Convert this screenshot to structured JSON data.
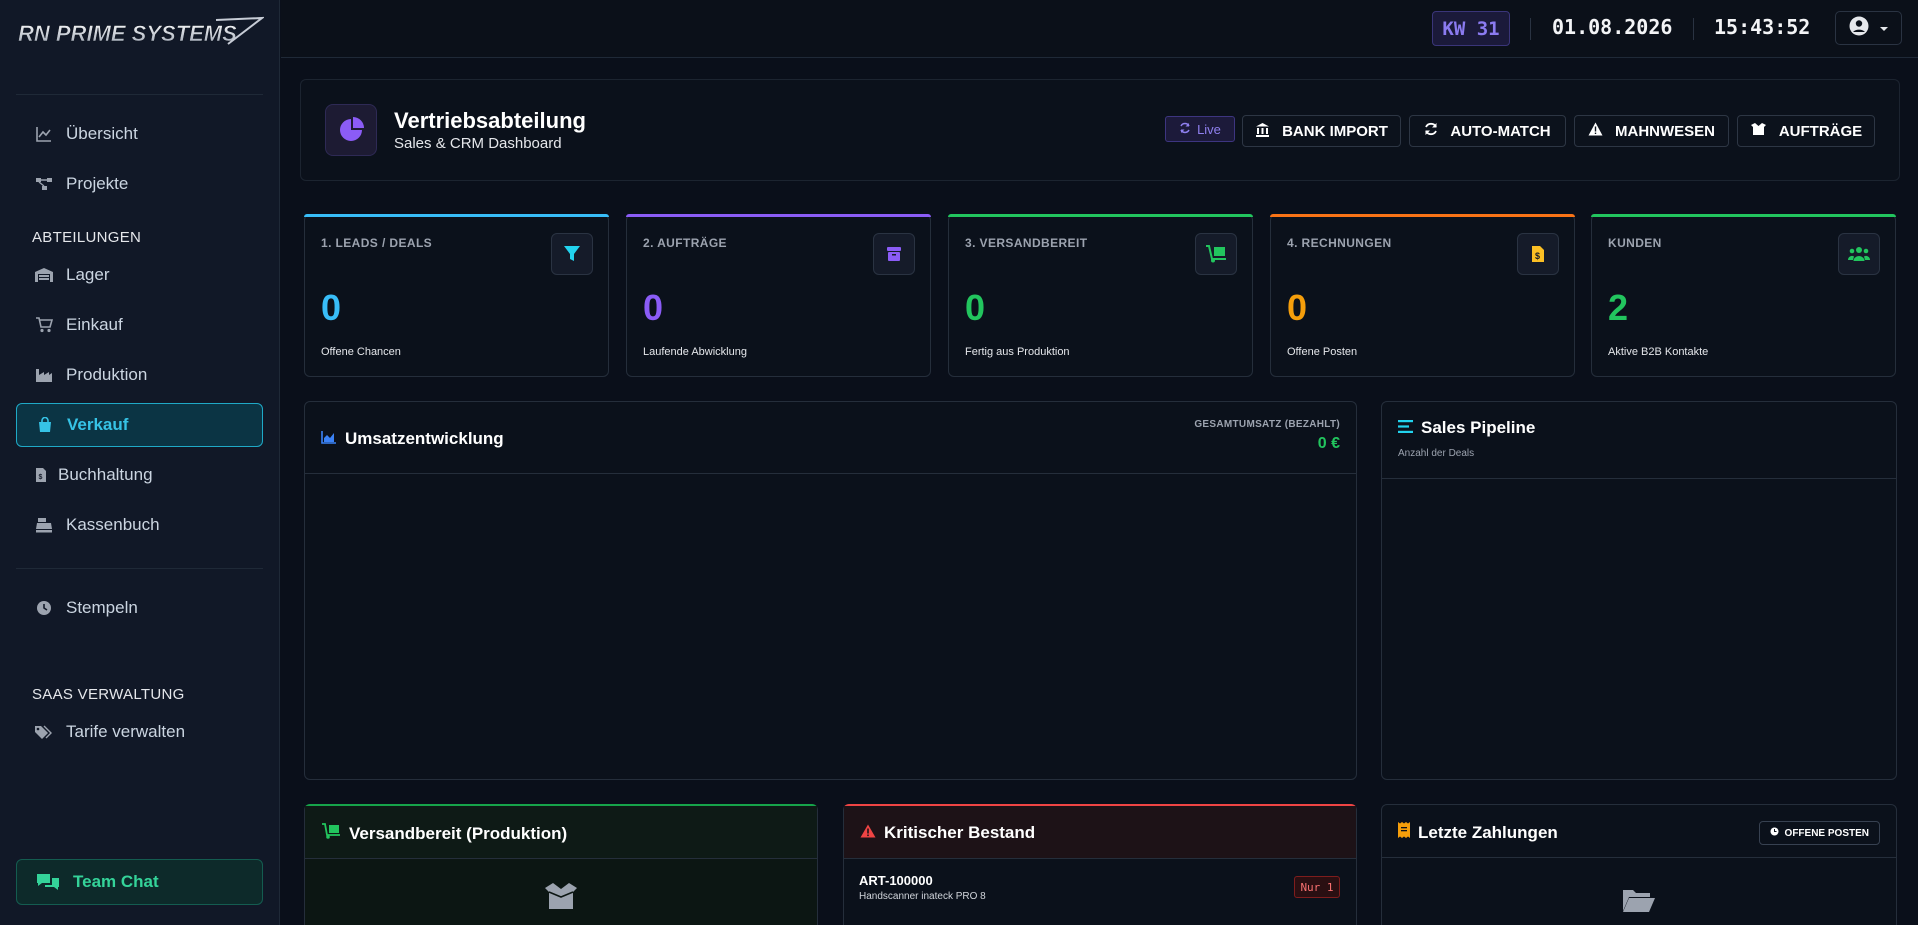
{
  "brand": {
    "logo_text": "RN PRIME SYSTEMS"
  },
  "sidebar": {
    "main_items": [
      {
        "label": "Übersicht",
        "icon": "chart-line-icon"
      },
      {
        "label": "Projekte",
        "icon": "project-diagram-icon"
      }
    ],
    "section_departments": "ABTEILUNGEN",
    "department_items": [
      {
        "label": "Lager",
        "icon": "warehouse-icon"
      },
      {
        "label": "Einkauf",
        "icon": "cart-icon"
      },
      {
        "label": "Produktion",
        "icon": "industry-icon"
      },
      {
        "label": "Verkauf",
        "icon": "shopping-bag-icon",
        "active": true
      },
      {
        "label": "Buchhaltung",
        "icon": "invoice-dollar-icon"
      },
      {
        "label": "Kassenbuch",
        "icon": "cash-register-icon"
      }
    ],
    "stempeln": {
      "label": "Stempeln",
      "icon": "clock-icon"
    },
    "section_saas": "SAAS VERWALTUNG",
    "saas_items": [
      {
        "label": "Tarife verwalten",
        "icon": "tags-icon"
      }
    ],
    "team_chat": {
      "label": "Team Chat",
      "icon": "comments-icon"
    }
  },
  "topbar": {
    "week": "KW 31",
    "date": "01.08.2026",
    "time": "15:43:52",
    "user_icon": "user-circle-icon"
  },
  "header": {
    "title": "Vertriebsabteilung",
    "subtitle": "Sales & CRM Dashboard",
    "icon": "chart-pie-icon",
    "live_label": "Live",
    "buttons": [
      {
        "label": "BANK IMPORT",
        "icon": "bank-icon"
      },
      {
        "label": "AUTO-MATCH",
        "icon": "sync-icon"
      },
      {
        "label": "MAHNWESEN",
        "icon": "warning-icon"
      },
      {
        "label": "AUFTRÄGE",
        "icon": "box-open-icon"
      }
    ]
  },
  "stats": [
    {
      "label": "1. LEADS / DEALS",
      "value": "0",
      "desc": "Offene Chancen",
      "icon": "filter-icon",
      "color": "#38bdf8"
    },
    {
      "label": "2. AUFTRÄGE",
      "value": "0",
      "desc": "Laufende Abwicklung",
      "icon": "box-icon",
      "color": "#8b5cf6"
    },
    {
      "label": "3. VERSANDBEREIT",
      "value": "0",
      "desc": "Fertig aus Produktion",
      "icon": "dolly-icon",
      "color": "#22c55e"
    },
    {
      "label": "4. RECHNUNGEN",
      "value": "0",
      "desc": "Offene Posten",
      "icon": "invoice-dollar-icon",
      "color": "#f59e0b"
    },
    {
      "label": "KUNDEN",
      "value": "2",
      "desc": "Aktive B2B Kontakte",
      "icon": "users-icon",
      "color": "#22c55e"
    }
  ],
  "revenue": {
    "title": "Umsatzentwicklung",
    "icon": "chart-area-icon",
    "total_label": "GESAMTUMSATZ (BEZAHLT)",
    "total_value": "0 €"
  },
  "pipeline": {
    "title": "Sales Pipeline",
    "subtitle": "Anzahl der Deals",
    "icon": "bars-icon"
  },
  "shipping": {
    "title": "Versandbereit (Produktion)",
    "icon": "dolly-icon",
    "empty_icon": "box-open-icon"
  },
  "critical": {
    "title": "Kritischer Bestand",
    "icon": "warning-icon",
    "items": [
      {
        "code": "ART-100000",
        "name": "Handscanner inateck PRO 8",
        "badge": "Nur 1"
      }
    ]
  },
  "payments": {
    "title": "Letzte Zahlungen",
    "icon": "receipt-icon",
    "button_label": "OFFENE POSTEN",
    "button_icon": "hourglass-icon",
    "empty_icon": "folder-open-icon"
  }
}
